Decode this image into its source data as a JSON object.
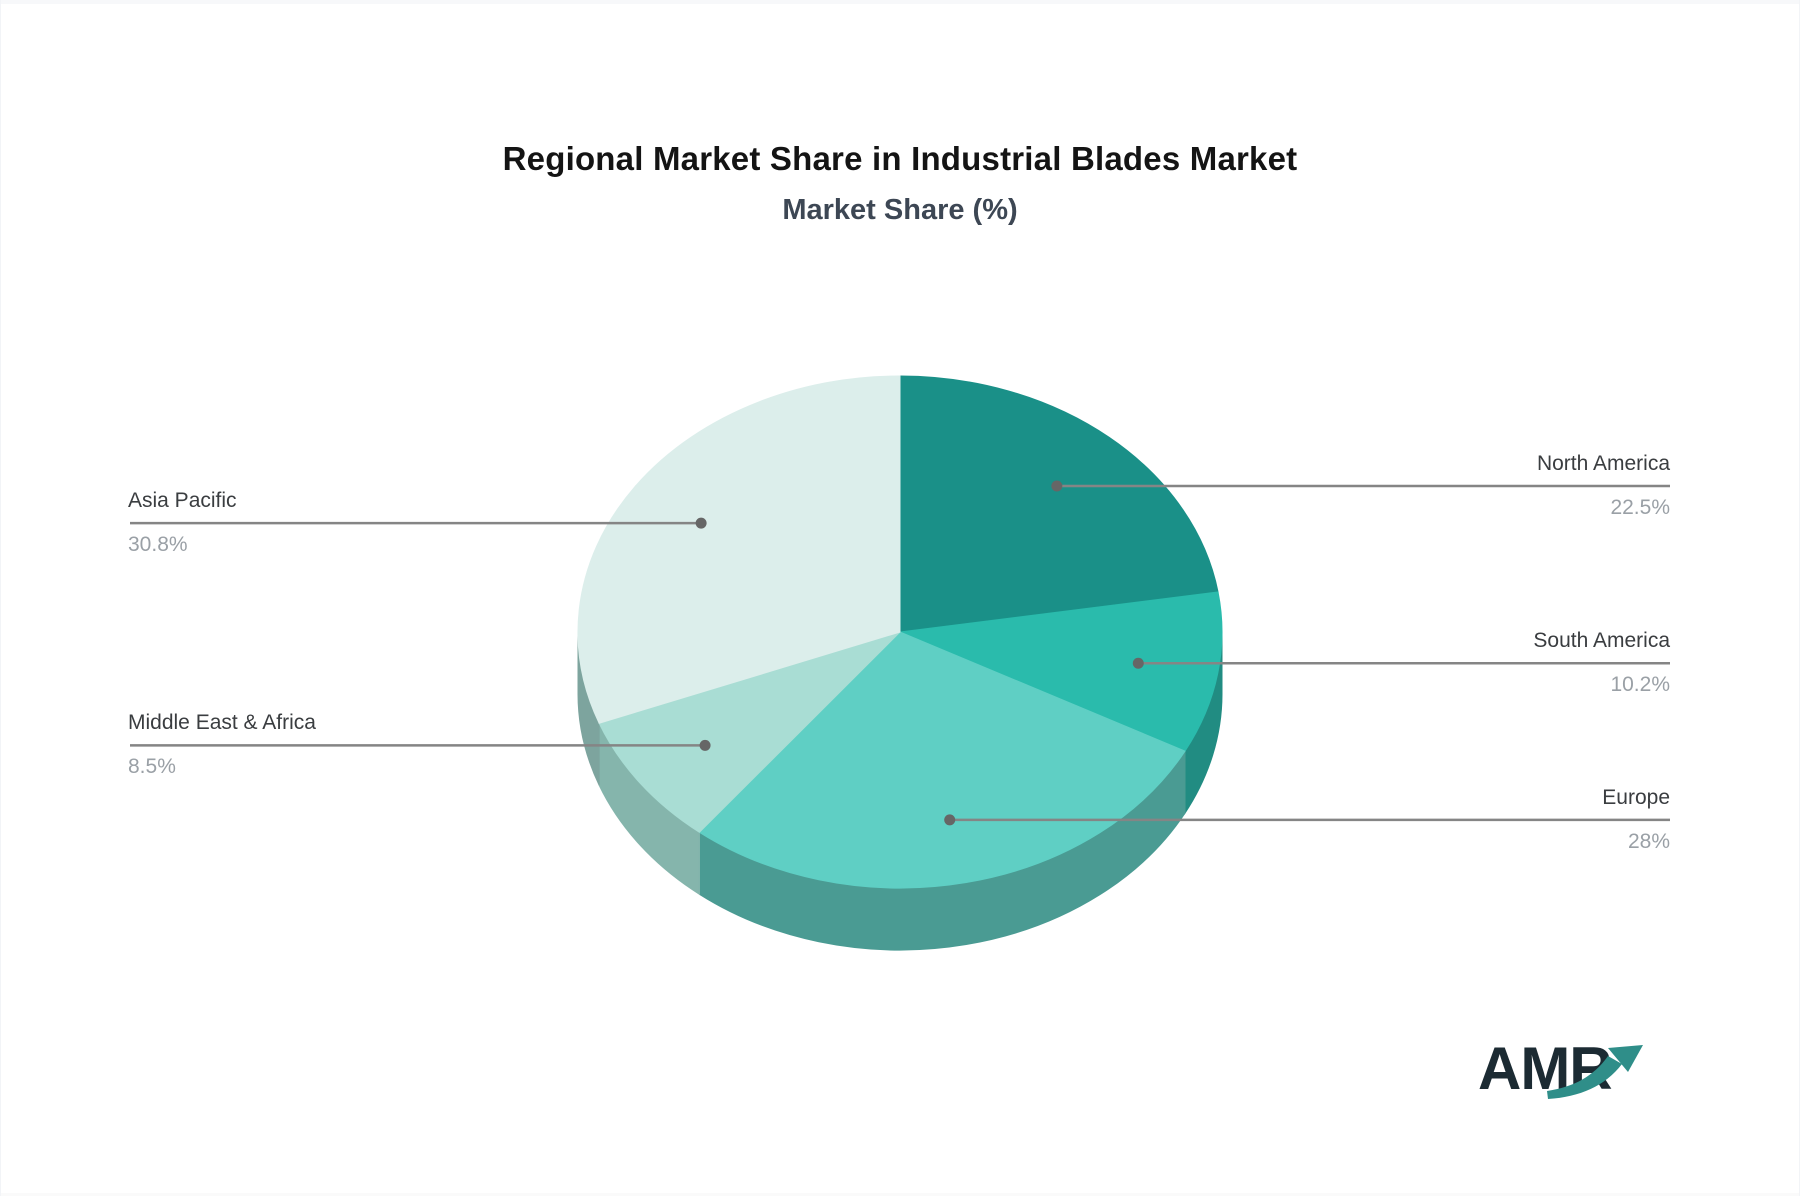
{
  "header": {
    "title": "Regional Market Share in Industrial Blades Market",
    "subtitle": "Market Share (%)"
  },
  "chart_data": {
    "type": "pie",
    "title": "Regional Market Share in Industrial Blades Market",
    "subtitle": "Market Share (%)",
    "unit": "%",
    "style": "3d-pie",
    "start_angle": "12-o'clock",
    "direction": "clockwise",
    "legend": "none (leader-line labels)",
    "slices": [
      {
        "label": "North America",
        "value": 22.5,
        "display": "22.5%",
        "color": "#1A9088",
        "side_color": "#17776F",
        "label_side": "right"
      },
      {
        "label": "South America",
        "value": 10.2,
        "display": "10.2%",
        "color": "#2ABBAC",
        "side_color": "#218C82",
        "label_side": "right"
      },
      {
        "label": "Europe",
        "value": 28,
        "display": "28%",
        "color": "#5FCFC4",
        "side_color": "#4A9B93",
        "label_side": "right"
      },
      {
        "label": "Middle East & Africa",
        "value": 8.5,
        "display": "8.5%",
        "color": "#A9DDD4",
        "side_color": "#85B5AC",
        "label_side": "left"
      },
      {
        "label": "Asia Pacific",
        "value": 30.8,
        "display": "30.8%",
        "color": "#DCEEEB",
        "side_color": "#7DA49E",
        "label_side": "left"
      }
    ]
  },
  "labels_style": {
    "name_color": "#3a3d40",
    "value_color": "#9aa0a6",
    "leader_line_color": "#858585",
    "leader_dot_color": "#666666"
  },
  "branding": {
    "logo_text": "AMR",
    "logo_text_color": "#1c2b33",
    "logo_arrow_color": "#2F8E89"
  }
}
